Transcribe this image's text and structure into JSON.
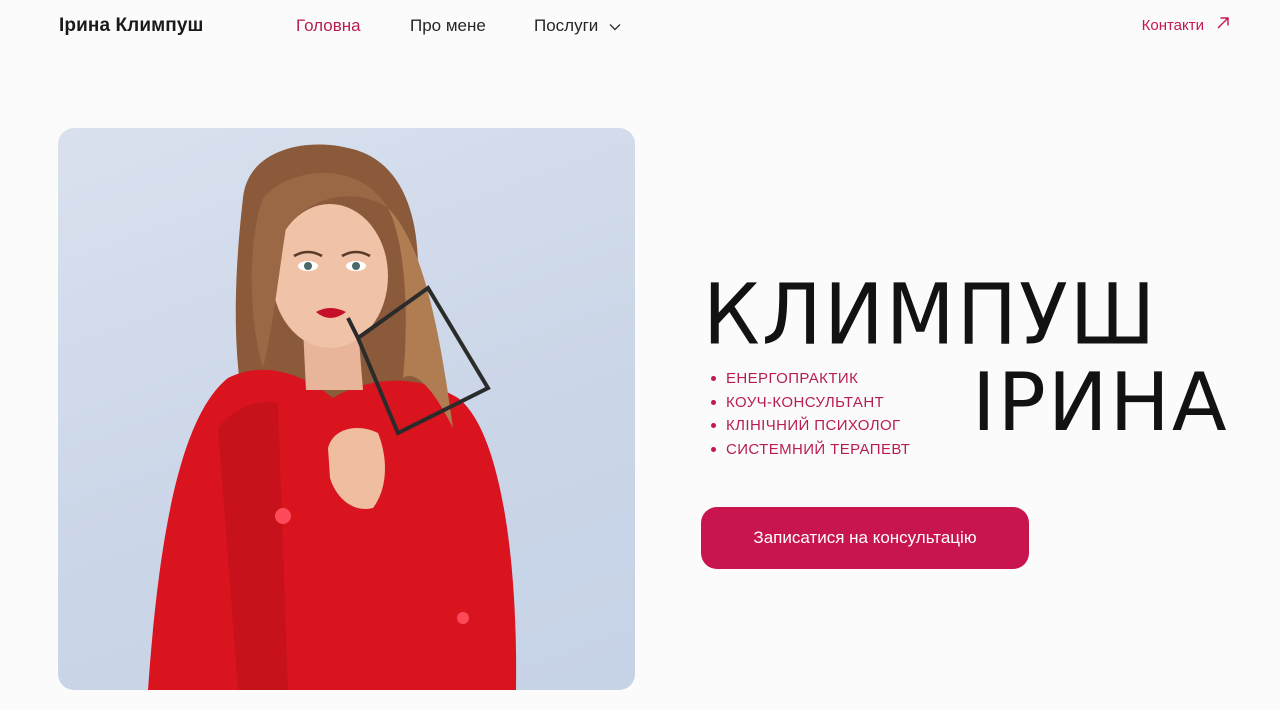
{
  "header": {
    "brand": "Ірина Климпуш",
    "nav": [
      {
        "label": "Головна",
        "active": true
      },
      {
        "label": "Про мене",
        "active": false
      },
      {
        "label": "Послуги",
        "active": false,
        "icon": "chevron-down-icon"
      }
    ],
    "contacts": {
      "label": "Контакти",
      "icon": "arrow-up-right-icon"
    }
  },
  "hero": {
    "title_line1": "КЛИМПУШ",
    "title_line2": "ІРИНА",
    "roles": [
      "ЕНЕРГОПРАКТИК",
      "КОУЧ-КОНСУЛЬТАНТ",
      "КЛІНІЧНИЙ ПСИХОЛОГ",
      "СИСТЕМНИЙ ТЕРАПЕВТ"
    ],
    "cta_label": "Записатися на консультацію"
  },
  "colors": {
    "accent": "#c8154e",
    "background": "#fbfbfc",
    "text": "#121212"
  }
}
